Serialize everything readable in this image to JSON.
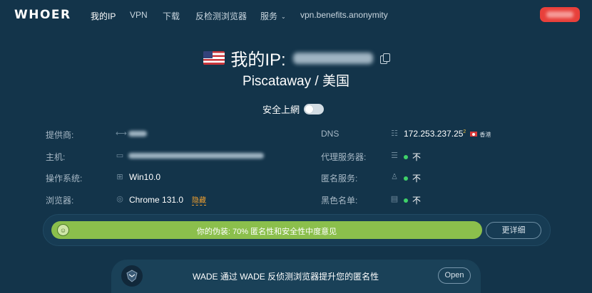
{
  "nav": {
    "logo": "WHOER",
    "links": [
      "我的IP",
      "VPN",
      "下载",
      "反检测浏览器",
      "服务",
      "vpn.benefits.anonymity"
    ],
    "services_caret": "⌄",
    "accent_color": "#e8403b"
  },
  "hero": {
    "ip_label": "我的IP:",
    "location": "Piscataway / 美国",
    "secure_label": "安全上網",
    "secure_toggle_on": false
  },
  "info_left": [
    {
      "label": "提供商:",
      "icon": "network-icon",
      "value": ""
    },
    {
      "label": "主机:",
      "icon": "host-icon",
      "value": ""
    },
    {
      "label": "操作系统:",
      "icon": "windows-icon",
      "value": "Win10.0"
    },
    {
      "label": "浏览器:",
      "icon": "browser-icon",
      "value": "Chrome 131.0",
      "extra": "隐藏"
    }
  ],
  "info_right": [
    {
      "label": "DNS",
      "icon": "dns-icon",
      "value": "172.253.237.25",
      "sup": "2",
      "region": "香港"
    },
    {
      "label": "代理服务器:",
      "icon": "proxy-icon",
      "value": "不"
    },
    {
      "label": "匿名服务:",
      "icon": "anonymizer-icon",
      "value": "不"
    },
    {
      "label": "黑色名单:",
      "icon": "blacklist-icon",
      "value": "不"
    }
  ],
  "disguise": {
    "text": "你的伪装: 70% 匿名性和安全性中度意见",
    "percent": 70,
    "details_label": "更详细",
    "bar_color": "#8bbf4c"
  },
  "banner": {
    "text": "WADE 通过 WADE 反侦测浏览器提升您的匿名性",
    "open_label": "Open"
  }
}
